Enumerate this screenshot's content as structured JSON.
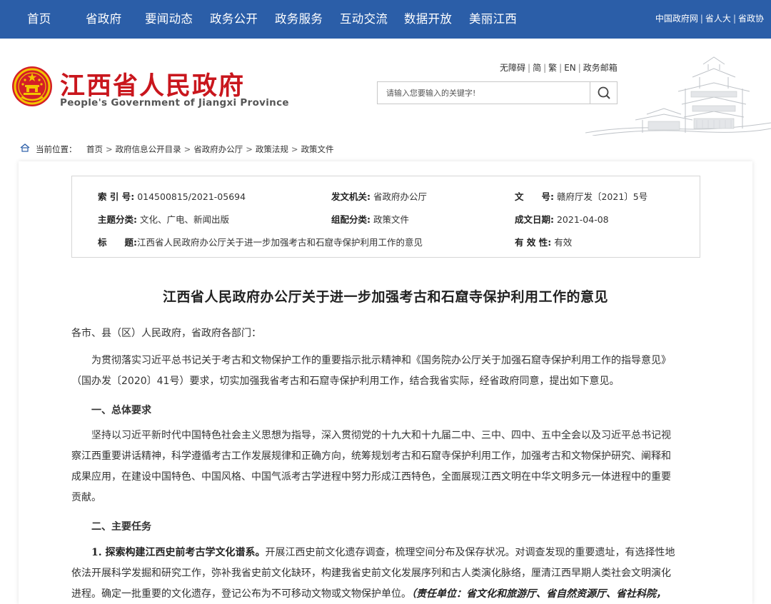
{
  "nav": {
    "items": [
      "首页",
      "省政府",
      "要闻动态",
      "政务公开",
      "政务服务",
      "互动交流",
      "数据开放",
      "美丽江西"
    ],
    "quick_links": [
      "中国政府网",
      "省人大",
      "省政协"
    ]
  },
  "header": {
    "title": "江西省人民政府",
    "subtitle": "People's Government of Jiangxi Province",
    "util_links": [
      "无障碍",
      "简",
      "繁",
      "EN",
      "政务邮箱"
    ],
    "search_placeholder": "请输入您要输入的关键字!"
  },
  "breadcrumb": {
    "label": "当前位置：",
    "path": [
      "首页",
      "政府信息公开目录",
      "省政府办公厅",
      "政策法规",
      "政策文件"
    ]
  },
  "meta": {
    "index_no_label": "索 引 号:",
    "index_no": "014500815/2021-05694",
    "issuer_label": "发文机关:",
    "issuer": "省政府办公厅",
    "doc_no_label": "文　　号:",
    "doc_no": "赣府厅发〔2021〕5号",
    "topic_label": "主题分类:",
    "topic": "文化、广电、新闻出版",
    "category_label": "组配分类:",
    "category": "政策文件",
    "date_label": "成文日期:",
    "date": "2021-04-08",
    "title_label": "标　　题:",
    "title": "江西省人民政府办公厅关于进一步加强考古和石窟寺保护利用工作的意见",
    "validity_label": "有 效 性:",
    "validity": "有效"
  },
  "doc": {
    "title": "江西省人民政府办公厅关于进一步加强考古和石窟寺保护利用工作的意见",
    "salutation": "各市、县（区）人民政府，省政府各部门：",
    "intro": [
      "为贯彻落实习近平总书记关于考古和文物保护工作的重要指示批示精神和《国务院办公厅关于加强石窟寺保护利用工作的指导意见》",
      "（国办发〔2020〕41号）要求，切实加强我省考古和石窟寺保护利用工作，结合我省实际，经省政府同意，提出如下意见。"
    ],
    "section1": "一、总体要求",
    "section1_body": [
      "坚持以习近平新时代中国特色社会主义思想为指导，深入贯彻党的十九大和十九届二中、三中、四中、五中全会以及习近平总书记视",
      "察江西重要讲话精神，科学遵循考古工作发展规律和正确方向，统筹规划考古和石窟寺保护利用工作，加强考古和文物保护研究、阐释和",
      "成果应用，在建设中国特色、中国风格、中国气派考古学进程中努力形成江西特色，全面展现江西文明在中华文明多元一体进程中的重要",
      "贡献。"
    ],
    "section2": "二、主要任务",
    "task1_title": "1. 探索构建江西史前考古学文化谱系。",
    "task1_line1": "开展江西史前文化遗存调查，梳理空间分布及保存状况。对调查发现的重要遗址，有选择性地",
    "task1_line2": "依法开展科学发掘和研究工作，弥补我省史前文化缺环，构建我省史前文化发展序列和古人类演化脉络，厘清江西早期人类社会文明演化",
    "task1_line3": "进程。确定一批重要的文化遗存，登记公布为不可移动文物或文物保护单位。",
    "task1_resp": "（责任单位：省文化和旅游厅、省自然资源厅、省社科院，"
  }
}
